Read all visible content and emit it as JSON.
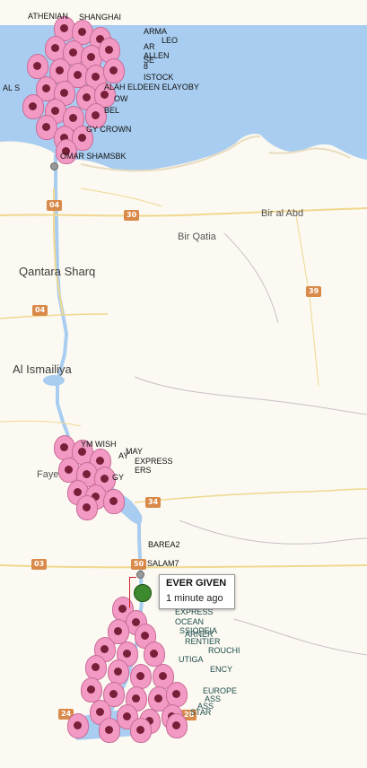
{
  "places": [
    {
      "id": "qantara",
      "name": "Qantara Sharq",
      "size": "big"
    },
    {
      "id": "ismailiya",
      "name": "Al Ismailiya",
      "size": "big"
    },
    {
      "id": "birabd",
      "name": "Bir al Abd",
      "size": "small"
    },
    {
      "id": "birqatia",
      "name": "Bir Qatia",
      "size": "small"
    },
    {
      "id": "faye",
      "name": "Faye",
      "size": "small"
    }
  ],
  "road_shields": [
    "04",
    "30",
    "04",
    "39",
    "34",
    "03",
    "50",
    "24",
    "28"
  ],
  "vessels_top": [
    "ATHENIAN",
    "SHANGHAI",
    "ALLEN",
    "ARMA",
    "ISTOCK",
    "ALAH ELDEEN ELAYOBY",
    "AL S",
    "OW",
    "BEL",
    "GY CROWN",
    "OMAR SHAMSBK",
    "AR",
    "LEO",
    "8",
    "SE"
  ],
  "vessels_mid": [
    "YM WISH",
    "EXPRESS",
    "MAY",
    "ERS",
    "GY",
    "AY"
  ],
  "vessels_bottom": [
    "BAREA2",
    "SALAM7",
    "EXPRESS",
    "OCEAN",
    "SSIOPEIA",
    "RENTIER",
    "ROUCHI",
    "UTIGA",
    "ARNER",
    "ENCY",
    "EUROPE",
    "ASS",
    "ASS",
    "STAR"
  ],
  "tooltip": {
    "title": "EVER GIVEN",
    "subtitle": "1 minute ago"
  }
}
